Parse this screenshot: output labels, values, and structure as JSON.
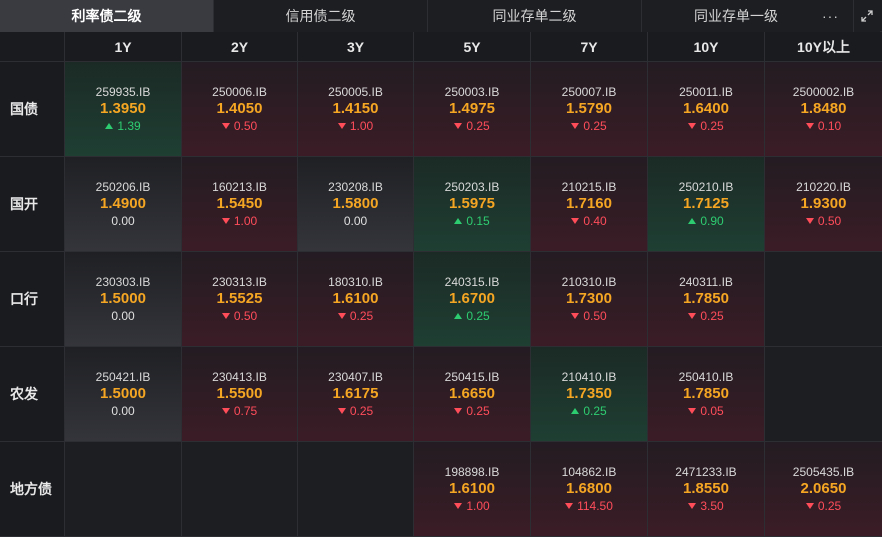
{
  "tabs": [
    {
      "label": "利率债二级",
      "active": true
    },
    {
      "label": "信用债二级",
      "active": false
    },
    {
      "label": "同业存单二级",
      "active": false
    },
    {
      "label": "同业存单一级",
      "active": false
    }
  ],
  "more_label": "···",
  "columns": [
    "1Y",
    "2Y",
    "3Y",
    "5Y",
    "7Y",
    "10Y",
    "10Y以上"
  ],
  "rows": [
    {
      "label": "国债",
      "cells": [
        {
          "code": "259935.IB",
          "yield": "1.3950",
          "change": "1.39",
          "dir": "up"
        },
        {
          "code": "250006.IB",
          "yield": "1.4050",
          "change": "0.50",
          "dir": "down"
        },
        {
          "code": "250005.IB",
          "yield": "1.4150",
          "change": "1.00",
          "dir": "down"
        },
        {
          "code": "250003.IB",
          "yield": "1.4975",
          "change": "0.25",
          "dir": "down"
        },
        {
          "code": "250007.IB",
          "yield": "1.5790",
          "change": "0.25",
          "dir": "down"
        },
        {
          "code": "250011.IB",
          "yield": "1.6400",
          "change": "0.25",
          "dir": "down"
        },
        {
          "code": "2500002.IB",
          "yield": "1.8480",
          "change": "0.10",
          "dir": "down"
        }
      ]
    },
    {
      "label": "国开",
      "cells": [
        {
          "code": "250206.IB",
          "yield": "1.4900",
          "change": "0.00",
          "dir": "flat"
        },
        {
          "code": "160213.IB",
          "yield": "1.5450",
          "change": "1.00",
          "dir": "down"
        },
        {
          "code": "230208.IB",
          "yield": "1.5800",
          "change": "0.00",
          "dir": "flat"
        },
        {
          "code": "250203.IB",
          "yield": "1.5975",
          "change": "0.15",
          "dir": "up"
        },
        {
          "code": "210215.IB",
          "yield": "1.7160",
          "change": "0.40",
          "dir": "down"
        },
        {
          "code": "250210.IB",
          "yield": "1.7125",
          "change": "0.90",
          "dir": "up"
        },
        {
          "code": "210220.IB",
          "yield": "1.9300",
          "change": "0.50",
          "dir": "down"
        }
      ]
    },
    {
      "label": "口行",
      "cells": [
        {
          "code": "230303.IB",
          "yield": "1.5000",
          "change": "0.00",
          "dir": "flat"
        },
        {
          "code": "230313.IB",
          "yield": "1.5525",
          "change": "0.50",
          "dir": "down"
        },
        {
          "code": "180310.IB",
          "yield": "1.6100",
          "change": "0.25",
          "dir": "down"
        },
        {
          "code": "240315.IB",
          "yield": "1.6700",
          "change": "0.25",
          "dir": "up"
        },
        {
          "code": "210310.IB",
          "yield": "1.7300",
          "change": "0.50",
          "dir": "down"
        },
        {
          "code": "240311.IB",
          "yield": "1.7850",
          "change": "0.25",
          "dir": "down"
        },
        null
      ]
    },
    {
      "label": "农发",
      "cells": [
        {
          "code": "250421.IB",
          "yield": "1.5000",
          "change": "0.00",
          "dir": "flat"
        },
        {
          "code": "230413.IB",
          "yield": "1.5500",
          "change": "0.75",
          "dir": "down"
        },
        {
          "code": "230407.IB",
          "yield": "1.6175",
          "change": "0.25",
          "dir": "down"
        },
        {
          "code": "250415.IB",
          "yield": "1.6650",
          "change": "0.25",
          "dir": "down"
        },
        {
          "code": "210410.IB",
          "yield": "1.7350",
          "change": "0.25",
          "dir": "up"
        },
        {
          "code": "250410.IB",
          "yield": "1.7850",
          "change": "0.05",
          "dir": "down"
        },
        null
      ]
    },
    {
      "label": "地方债",
      "cells": [
        null,
        null,
        null,
        {
          "code": "198898.IB",
          "yield": "1.6100",
          "change": "1.00",
          "dir": "down"
        },
        {
          "code": "104862.IB",
          "yield": "1.6800",
          "change": "114.50",
          "dir": "down"
        },
        {
          "code": "2471233.IB",
          "yield": "1.8550",
          "change": "3.50",
          "dir": "down"
        },
        {
          "code": "2505435.IB",
          "yield": "2.0650",
          "change": "0.25",
          "dir": "down"
        }
      ]
    }
  ],
  "colors": {
    "yield": "#f5a623",
    "up": "#2ecc71",
    "down": "#ff4d5a",
    "active_tab": "#3a3b40"
  },
  "icons": {
    "more": "more-dots-icon",
    "expand": "expand-icon"
  }
}
